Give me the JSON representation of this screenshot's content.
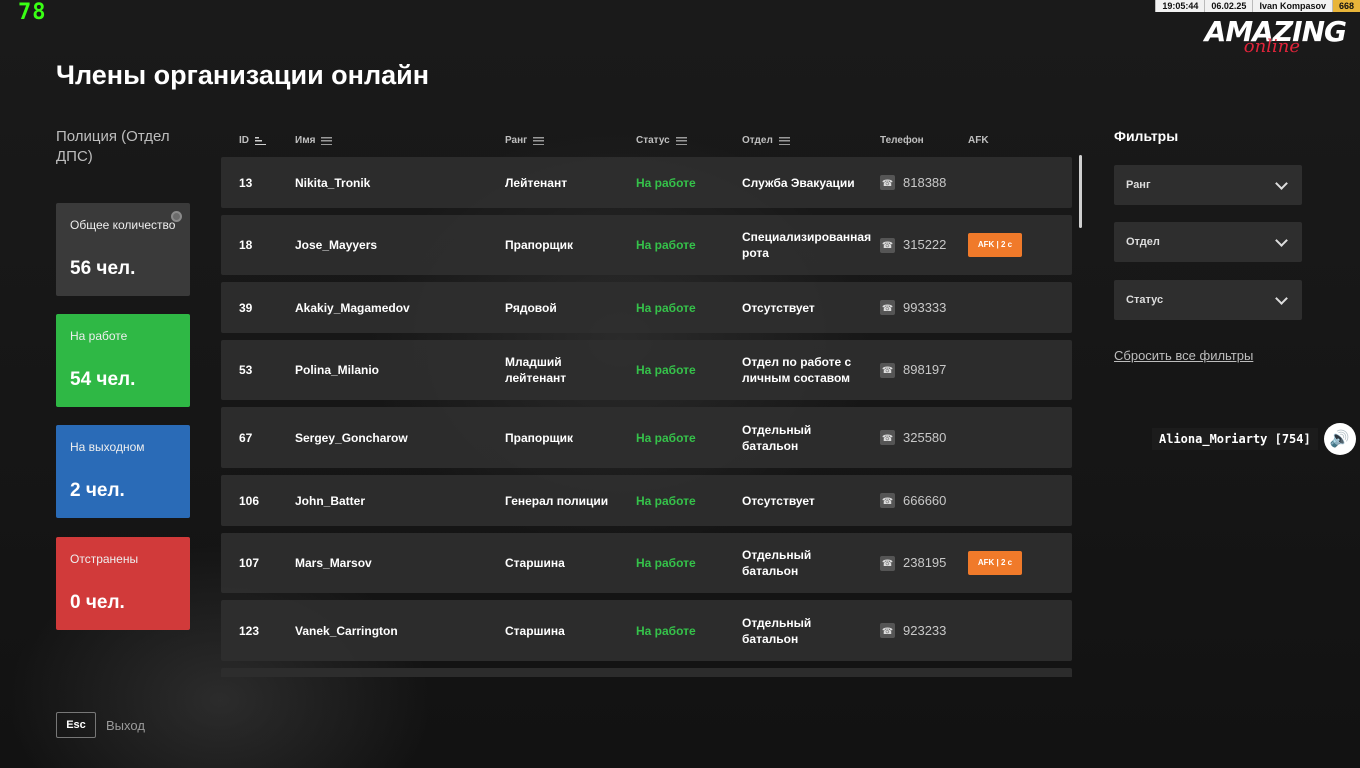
{
  "hud": {
    "fps": "78",
    "time": "19:05:44",
    "date": "06.02.25",
    "player": "Ivan Kompasov",
    "level": "668"
  },
  "logo": {
    "line1": "AMAZING",
    "line2": "online"
  },
  "title": "Члены организации онлайн",
  "org_name": "Полиция (Отдел ДПС)",
  "stats": {
    "total": {
      "label": "Общее количество",
      "value": "56 чел."
    },
    "working": {
      "label": "На работе",
      "value": "54 чел."
    },
    "off": {
      "label": "На выходном",
      "value": "2 чел."
    },
    "suspended": {
      "label": "Отстранены",
      "value": "0 чел."
    }
  },
  "table": {
    "headers": {
      "id": "ID",
      "name": "Имя",
      "rank": "Ранг",
      "status": "Статус",
      "dept": "Отдел",
      "phone": "Телефон",
      "afk": "AFK"
    },
    "rows": [
      {
        "id": "13",
        "name": "Nikita_Tronik",
        "rank": "Лейтенант",
        "status": "На работе",
        "dept": "Служба Эвакуации",
        "phone": "818388",
        "afk": ""
      },
      {
        "id": "18",
        "name": "Jose_Mayyers",
        "rank": "Прапорщик",
        "status": "На работе",
        "dept": "Специализированная рота",
        "phone": "315222",
        "afk": "AFK | 2 с"
      },
      {
        "id": "39",
        "name": "Akakiy_Magamedov",
        "rank": "Рядовой",
        "status": "На работе",
        "dept": "Отсутствует",
        "phone": "993333",
        "afk": ""
      },
      {
        "id": "53",
        "name": "Polina_Milanio",
        "rank": "Младший лейтенант",
        "status": "На работе",
        "dept": "Отдел по работе с личным составом",
        "phone": "898197",
        "afk": ""
      },
      {
        "id": "67",
        "name": "Sergey_Goncharow",
        "rank": "Прапорщик",
        "status": "На работе",
        "dept": "Отдельный батальон",
        "phone": "325580",
        "afk": ""
      },
      {
        "id": "106",
        "name": "John_Batter",
        "rank": "Генерал полиции",
        "status": "На работе",
        "dept": "Отсутствует",
        "phone": "666660",
        "afk": ""
      },
      {
        "id": "107",
        "name": "Mars_Marsov",
        "rank": "Старшина",
        "status": "На работе",
        "dept": "Отдельный батальон",
        "phone": "238195",
        "afk": "AFK | 2 с"
      },
      {
        "id": "123",
        "name": "Vanek_Carrington",
        "rank": "Старшина",
        "status": "На работе",
        "dept": "Отдельный батальон",
        "phone": "923233",
        "afk": ""
      },
      {
        "id": "",
        "name": "",
        "rank": "",
        "status": "",
        "dept": "",
        "phone": "",
        "afk": ""
      }
    ]
  },
  "filters": {
    "title": "Фильтры",
    "rank": "Ранг",
    "dept": "Отдел",
    "status": "Статус",
    "reset": "Сбросить все фильтры"
  },
  "voice": {
    "name": "Aliona_Moriarty [754]"
  },
  "exit": {
    "key": "Esc",
    "label": "Выход"
  },
  "colors": {
    "working": "#2fb845",
    "off": "#2a6bb7",
    "suspended": "#d13a3a",
    "afk": "#f07a2a",
    "status_text": "#35c24a"
  }
}
